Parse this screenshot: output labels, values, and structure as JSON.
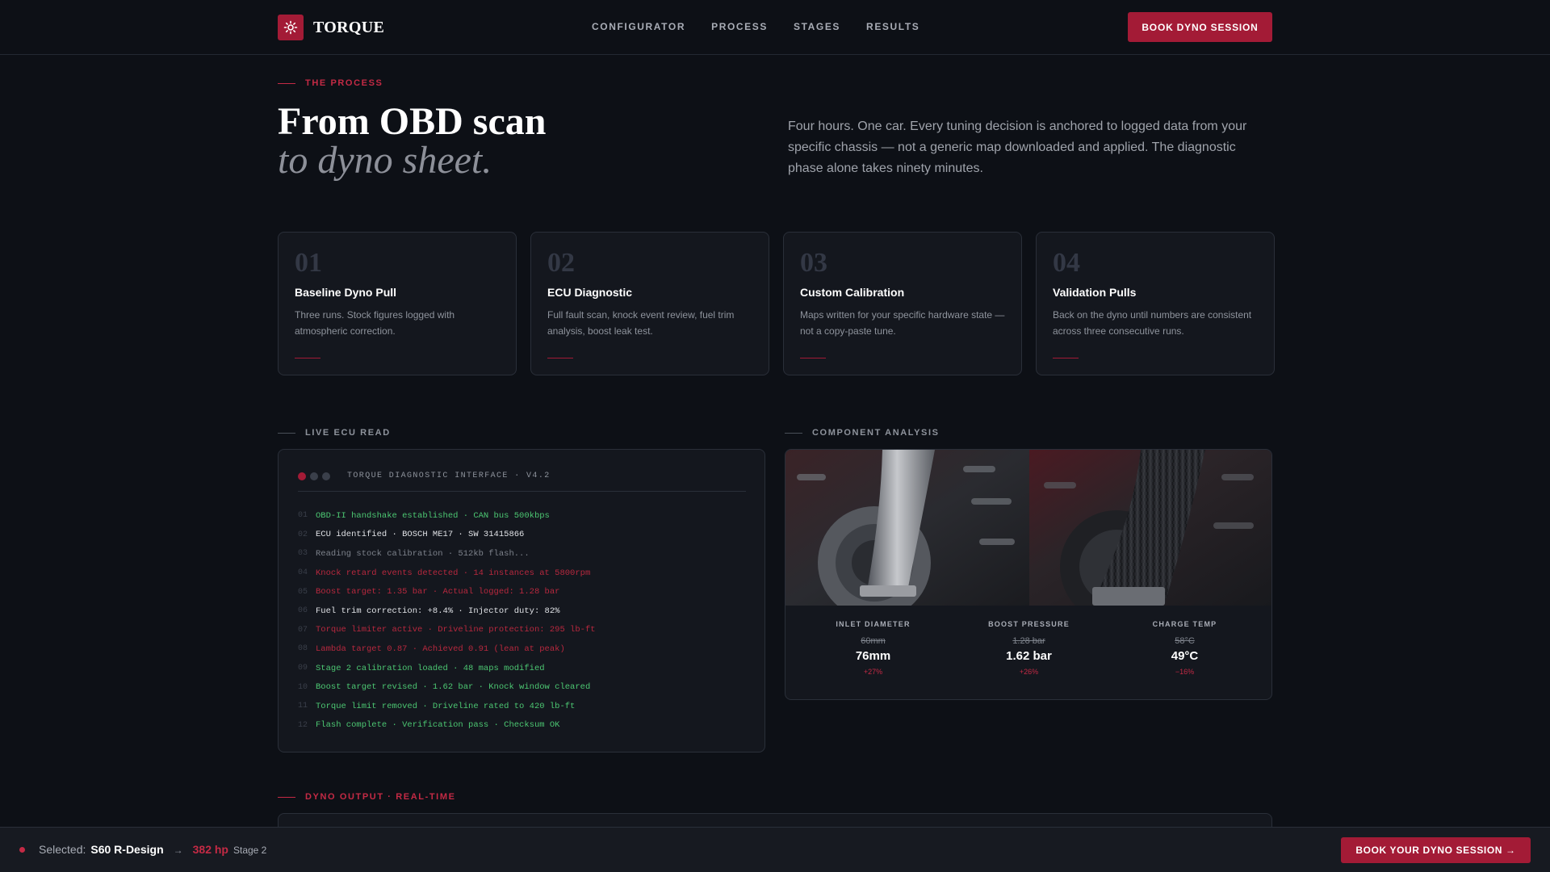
{
  "brand": {
    "name": "TORQUE",
    "logo_icon": "sun-gear-icon"
  },
  "nav": {
    "items": [
      {
        "label": "CONFIGURATOR"
      },
      {
        "label": "PROCESS"
      },
      {
        "label": "STAGES"
      },
      {
        "label": "RESULTS"
      }
    ],
    "cta_label": "BOOK DYNO SESSION"
  },
  "hero": {
    "eyebrow": "THE PROCESS",
    "title": "From OBD scan",
    "subtitle": "to dyno sheet.",
    "description": "Four hours. One car. Every tuning decision is anchored to logged data from your specific chassis — not a generic map downloaded and applied. The diagnostic phase alone takes ninety minutes."
  },
  "steps": [
    {
      "num": "01",
      "title": "Baseline Dyno Pull",
      "desc": "Three runs. Stock figures logged with atmospheric correction."
    },
    {
      "num": "02",
      "title": "ECU Diagnostic",
      "desc": "Full fault scan, knock event review, fuel trim analysis, boost leak test."
    },
    {
      "num": "03",
      "title": "Custom Calibration",
      "desc": "Maps written for your specific hardware state — not a copy-paste tune."
    },
    {
      "num": "04",
      "title": "Validation Pulls",
      "desc": "Back on the dyno until numbers are consistent across three consecutive runs."
    }
  ],
  "live_ecu": {
    "eyebrow": "LIVE ECU READ",
    "terminal_title": "TORQUE DIAGNOSTIC INTERFACE · V4.2",
    "lines": [
      {
        "n": "01",
        "text": "OBD-II handshake established · CAN bus 500kbps",
        "tone": "green"
      },
      {
        "n": "02",
        "text": "ECU identified · BOSCH ME17 · SW 31415866",
        "tone": "white"
      },
      {
        "n": "03",
        "text": "Reading stock calibration · 512kb flash...",
        "tone": "grey"
      },
      {
        "n": "04",
        "text": "Knock retard events detected · 14 instances at 5800rpm",
        "tone": "red"
      },
      {
        "n": "05",
        "text": "Boost target: 1.35 bar · Actual logged: 1.28 bar",
        "tone": "red"
      },
      {
        "n": "06",
        "text": "Fuel trim correction: +8.4% · Injector duty: 82%",
        "tone": "white"
      },
      {
        "n": "07",
        "text": "Torque limiter active · Driveline protection: 295 lb-ft",
        "tone": "red"
      },
      {
        "n": "08",
        "text": "Lambda target 0.87 · Achieved 0.91 (lean at peak)",
        "tone": "red"
      },
      {
        "n": "09",
        "text": "Stage 2 calibration loaded · 48 maps modified",
        "tone": "green"
      },
      {
        "n": "10",
        "text": "Boost target revised · 1.62 bar · Knock window cleared",
        "tone": "green"
      },
      {
        "n": "11",
        "text": "Torque limit removed · Driveline rated to 420 lb-ft",
        "tone": "green"
      },
      {
        "n": "12",
        "text": "Flash complete · Verification pass · Checksum OK",
        "tone": "green"
      }
    ]
  },
  "component": {
    "eyebrow": "COMPONENT ANALYSIS",
    "metrics": [
      {
        "label": "INLET DIAMETER",
        "old": "60mm",
        "new": "76mm",
        "delta": "+27%"
      },
      {
        "label": "BOOST PRESSURE",
        "old": "1.28 bar",
        "new": "1.62 bar",
        "delta": "+26%"
      },
      {
        "label": "CHARGE TEMP",
        "old": "58°C",
        "new": "49°C",
        "delta": "−16%"
      }
    ]
  },
  "dyno": {
    "eyebrow": "DYNO OUTPUT · REAL-TIME"
  },
  "footer": {
    "selected_label": "Selected:",
    "model": "S60 R-Design",
    "arrow": "→",
    "hp": "382 hp",
    "stage": "Stage 2",
    "cta_label": "BOOK YOUR DYNO SESSION →"
  },
  "colors": {
    "accent": "#a31b36",
    "accent_text": "#c42a45",
    "bg": "#0d1016",
    "card": "#14171e",
    "ok": "#4cc772"
  }
}
